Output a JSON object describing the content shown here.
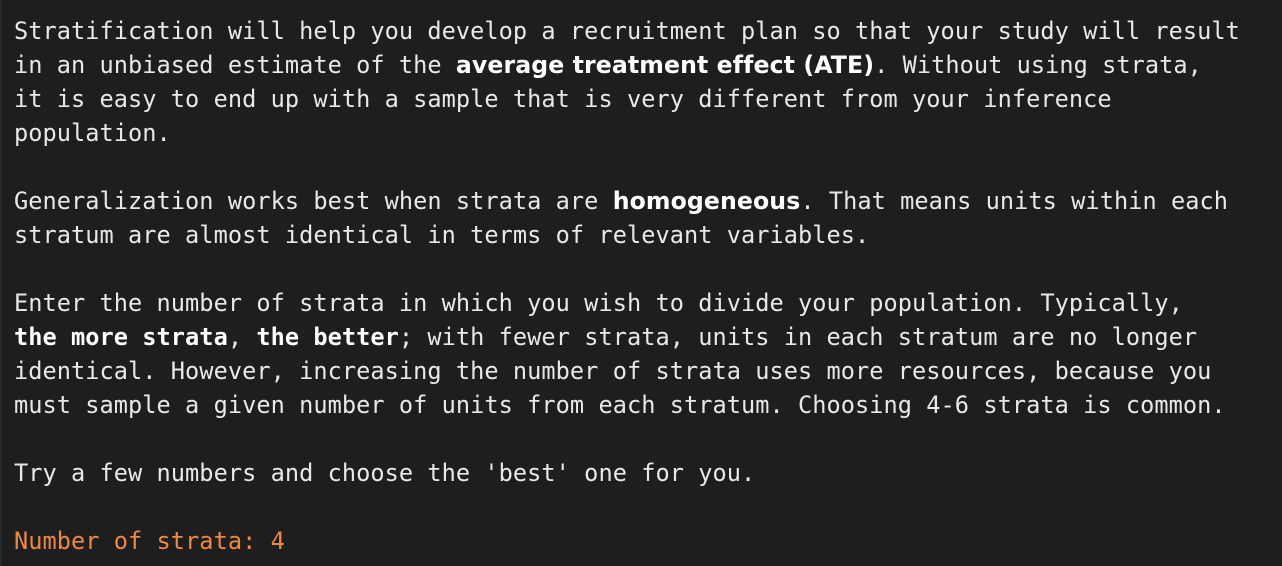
{
  "paragraph1": {
    "line1": "Stratification will help you develop a recruitment plan so that your study will result",
    "line2_pre": "in an unbiased estimate of the ",
    "line2_bold": "average treatment effect (ATE)",
    "line2_post": ". Without using strata,",
    "line3": "it is easy to end up with a sample that is very different from your inference",
    "line4": "population."
  },
  "paragraph2": {
    "line1_pre": "Generalization works best when strata are ",
    "line1_bold": "homogeneous",
    "line1_post": ". That means units within each",
    "line2": "stratum are almost identical in terms of relevant variables."
  },
  "paragraph3": {
    "line1": "Enter the number of strata in which you wish to divide your population. Typically,",
    "line2_bold1": "the more strata",
    "line2_mid": ", ",
    "line2_bold2": "the better",
    "line2_post": "; with fewer strata, units in each stratum are no longer",
    "line3": "identical. However, increasing the number of strata uses more resources, because you",
    "line4": "must sample a given number of units from each stratum. Choosing 4-6 strata is common."
  },
  "paragraph4": {
    "line1": "Try a few numbers and choose the 'best' one for you."
  },
  "prompt": {
    "label": "Number of strata: ",
    "value": "4",
    "color": "#f0883e"
  }
}
